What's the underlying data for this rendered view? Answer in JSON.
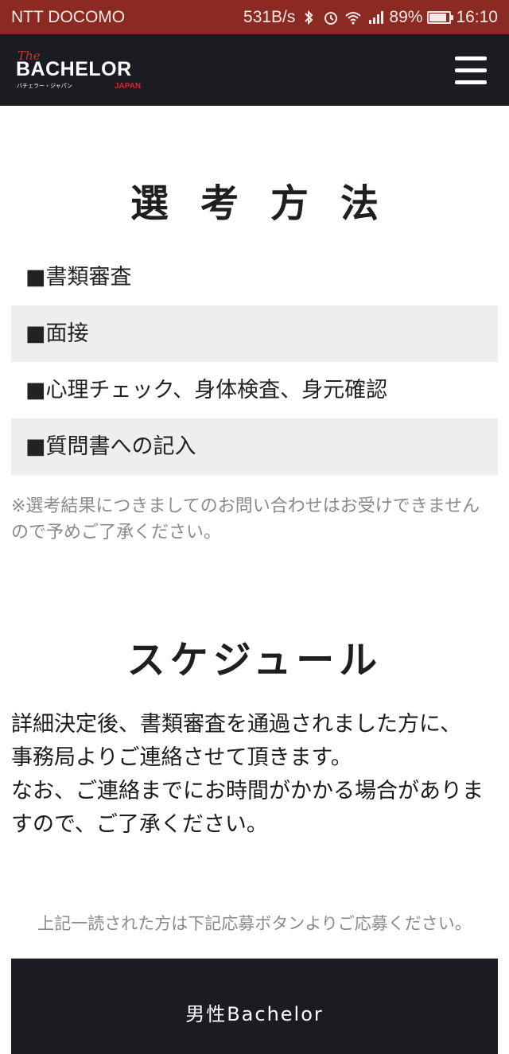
{
  "status_bar": {
    "carrier": "NTT DOCOMO",
    "net_speed": "531B/s",
    "battery_percent": "89%",
    "battery_level": 0.89,
    "time": "16:10",
    "icons": [
      "bluetooth-icon",
      "alarm-icon",
      "wifi-icon",
      "signal-icon",
      "battery-icon"
    ]
  },
  "header": {
    "logo": {
      "the": "The",
      "main": "BACHELOR",
      "sub": "バチェラー・ジャパン",
      "japan": "JAPAN"
    },
    "menu_icon": "hamburger-menu-icon"
  },
  "selection": {
    "title": "選考方法",
    "methods": [
      "■書類審査",
      "■面接",
      "■心理チェック、身体検査、身元確認",
      "■質問書への記入"
    ],
    "note": "※選考結果につきましてのお問い合わせはお受けできませんので予めご了承ください。"
  },
  "schedule": {
    "title": "スケジュール",
    "body_line1": "詳細決定後、書類審査を通過されました方に、",
    "body_line2": "事務局よりご連絡させて頂きます。",
    "body_line3": "なお、ご連絡までにお時間がかかる場合がありますので、ご了承ください。"
  },
  "apply": {
    "note": "上記一読された方は下記応募ボタンよりご応募ください。",
    "button_label": "男性Bachelor"
  },
  "colors": {
    "status_bar_bg": "#8b2a22",
    "header_bg": "#1b1b22",
    "row_shade": "#eeeeee",
    "logo_accent": "#d7262e"
  }
}
